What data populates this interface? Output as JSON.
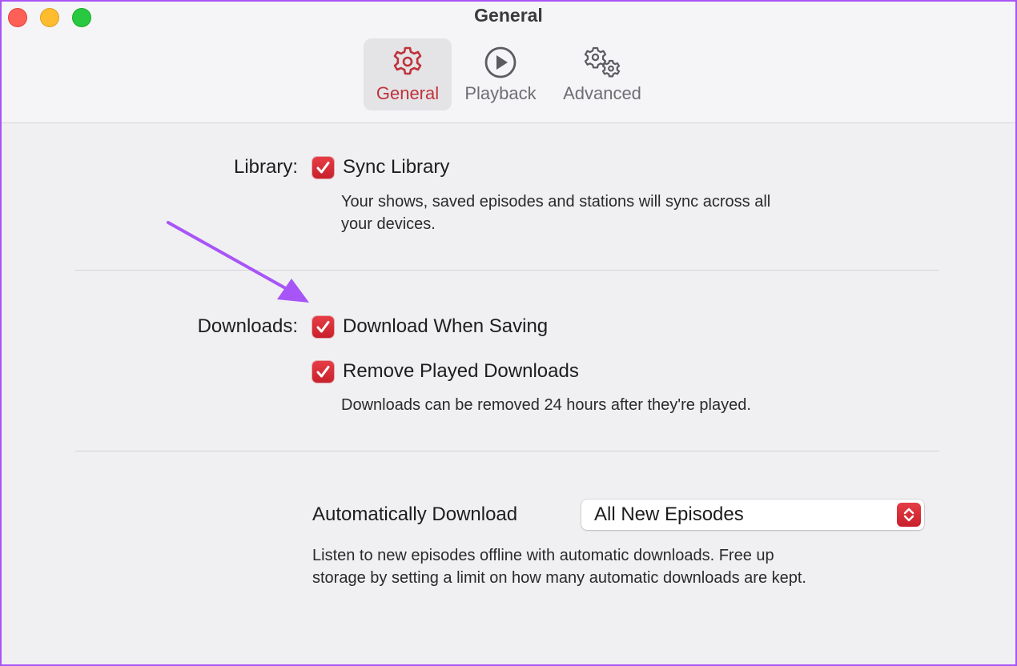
{
  "window": {
    "title": "General",
    "border_color": "#a855f7",
    "accent_color": "#d0262f"
  },
  "toolbar": {
    "tabs": [
      {
        "label": "General",
        "icon": "gear-icon",
        "active": true
      },
      {
        "label": "Playback",
        "icon": "play-circle-icon",
        "active": false
      },
      {
        "label": "Advanced",
        "icon": "gears-icon",
        "active": false
      }
    ]
  },
  "library": {
    "label": "Library:",
    "sync": {
      "label": "Sync Library",
      "checked": true
    },
    "description": "Your shows, saved episodes and stations will sync across all your devices.",
    "description_line1": "Your shows, saved episodes and stations will sync across all",
    "description_line2": "your devices."
  },
  "downloads": {
    "label": "Downloads:",
    "download_when_saving": {
      "label": "Download When Saving",
      "checked": true
    },
    "remove_played": {
      "label": "Remove Played Downloads",
      "checked": true
    },
    "remove_description": "Downloads can be removed 24 hours after they're played."
  },
  "auto_download": {
    "label": "Automatically Download",
    "selected": "All New Episodes",
    "description_line1": "Listen to new episodes offline with automatic downloads. Free up",
    "description_line2": "storage by setting a limit on how many automatic downloads are kept."
  },
  "annotation": {
    "arrow_color": "#a855f7",
    "points_to": "Download When Saving checkbox"
  }
}
